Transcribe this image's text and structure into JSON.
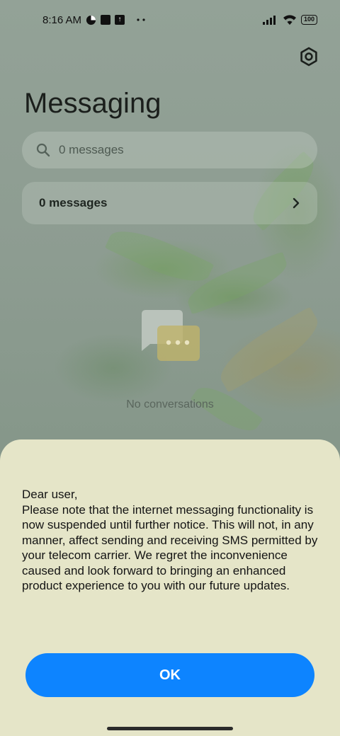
{
  "status_bar": {
    "time": "8:16 AM",
    "battery": "100",
    "icons": [
      "data-saver-icon",
      "square-notification-icon",
      "upload-notification-icon",
      "more-dots-icon",
      "signal-icon",
      "wifi-icon",
      "battery-icon"
    ]
  },
  "header": {
    "title": "Messaging",
    "settings_icon": "gear-icon"
  },
  "search": {
    "placeholder": "0 messages"
  },
  "messages_row": {
    "label": "0 messages"
  },
  "empty_state": {
    "text": "No conversations"
  },
  "dialog": {
    "message": "Dear user,\nPlease note that the internet messaging functionality is now suspended until further notice. This will not, in any manner, affect sending and receiving SMS permitted by your telecom carrier. We regret the inconvenience caused and look forward to bringing an enhanced product experience to you with our future updates.",
    "ok_label": "OK",
    "accent": "#0d84ff",
    "background": "#e5e5c8"
  }
}
